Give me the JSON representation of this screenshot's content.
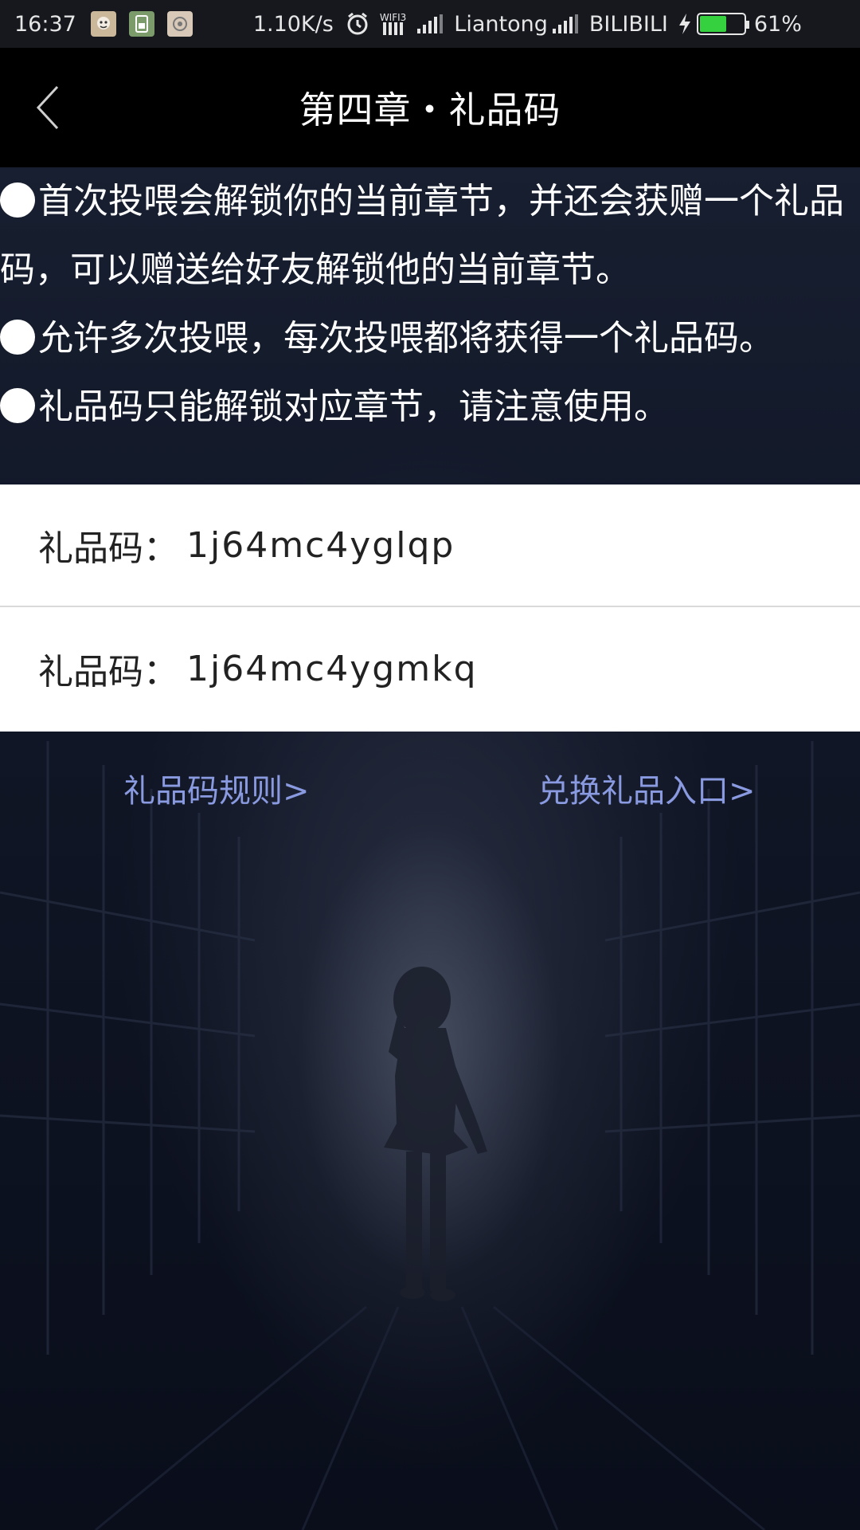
{
  "status_bar": {
    "time": "16:37",
    "net_speed": "1.10K/s",
    "wifi_label": "WIFI3",
    "carrier1": "Liantong",
    "carrier2": "BILIBILI",
    "battery_percent": "61%",
    "battery_level": 0.61
  },
  "header": {
    "title": "第四章・礼品码"
  },
  "info": {
    "lines": [
      "首次投喂会解锁你的当前章节，并还会获赠一个礼品码，可以赠送给好友解锁他的当前章节。",
      "允许多次投喂，每次投喂都将获得一个礼品码。",
      "礼品码只能解锁对应章节，请注意使用。"
    ]
  },
  "codes": {
    "label": "礼品码：",
    "items": [
      "1j64mc4yglqp",
      "1j64mc4ygmkq"
    ]
  },
  "links": {
    "rules": "礼品码规则>",
    "redeem": "兑换礼品入口>"
  },
  "colors": {
    "link": "#8a9ae0",
    "battery": "#35d13f",
    "header_bg": "#000000"
  }
}
